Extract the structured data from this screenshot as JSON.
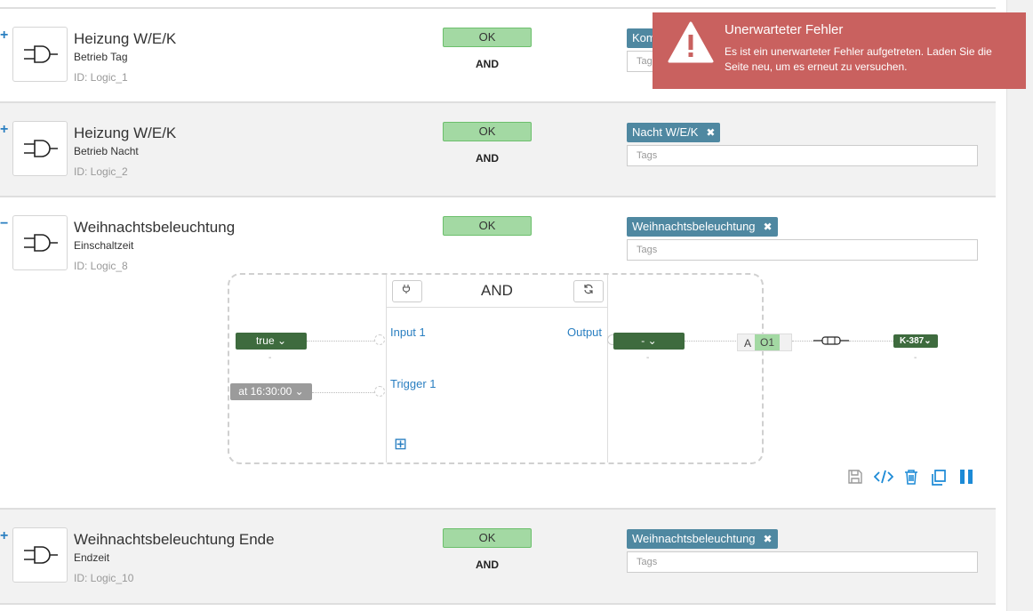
{
  "rows": [
    {
      "title": "Heizung W/E/K",
      "subtitle": "Betrieb Tag",
      "id": "ID: Logic_1",
      "status": "OK",
      "gate": "AND",
      "tag": "Kom",
      "tags_placeholder": "Tags",
      "expand": "+"
    },
    {
      "title": "Heizung W/E/K",
      "subtitle": "Betrieb Nacht",
      "id": "ID: Logic_2",
      "status": "OK",
      "gate": "AND",
      "tag": "Nacht W/E/K",
      "tags_placeholder": "Tags",
      "expand": "+"
    },
    {
      "title": "Weihnachtsbeleuchtung",
      "subtitle": "Einschaltzeit",
      "id": "ID: Logic_8",
      "status": "OK",
      "tag": "Weihnachtsbeleuchtung",
      "tags_placeholder": "Tags",
      "expand": "−"
    },
    {
      "title": "Weihnachtsbeleuchtung Ende",
      "subtitle": "Endzeit",
      "id": "ID: Logic_10",
      "status": "OK",
      "gate": "AND",
      "tag": "Weihnachtsbeleuchtung",
      "tags_placeholder": "Tags",
      "expand": "+"
    }
  ],
  "tag_remove_glyph": "✖",
  "editor": {
    "gate_name": "AND",
    "input1_value": "true ⌄",
    "input1_sub": "-",
    "trigger_value": "at 16:30:00 ⌄",
    "input1_label": "Input 1",
    "trigger_label": "Trigger 1",
    "output_label": "Output",
    "output_value": "- ⌄",
    "output_sub": "-",
    "ao_a": "A",
    "ao_o1": "O1",
    "target": "K-387⌄",
    "target_sub": "-",
    "add_glyph": "⊞"
  },
  "toast": {
    "title": "Unerwarteter Fehler",
    "message": "Es ist ein unerwarteter Fehler aufgetreten. Laden Sie die Seite neu, um es erneut zu versuchen."
  },
  "icons": {
    "toolbar": [
      "save-icon",
      "code-icon",
      "trash-icon",
      "copy-icon",
      "pause-icon"
    ]
  },
  "colors": {
    "ok_green": "#a3d9a3",
    "tag_blue": "#4f88a1",
    "toast_red": "#c9615f",
    "accent_blue": "#1c8ad6"
  }
}
